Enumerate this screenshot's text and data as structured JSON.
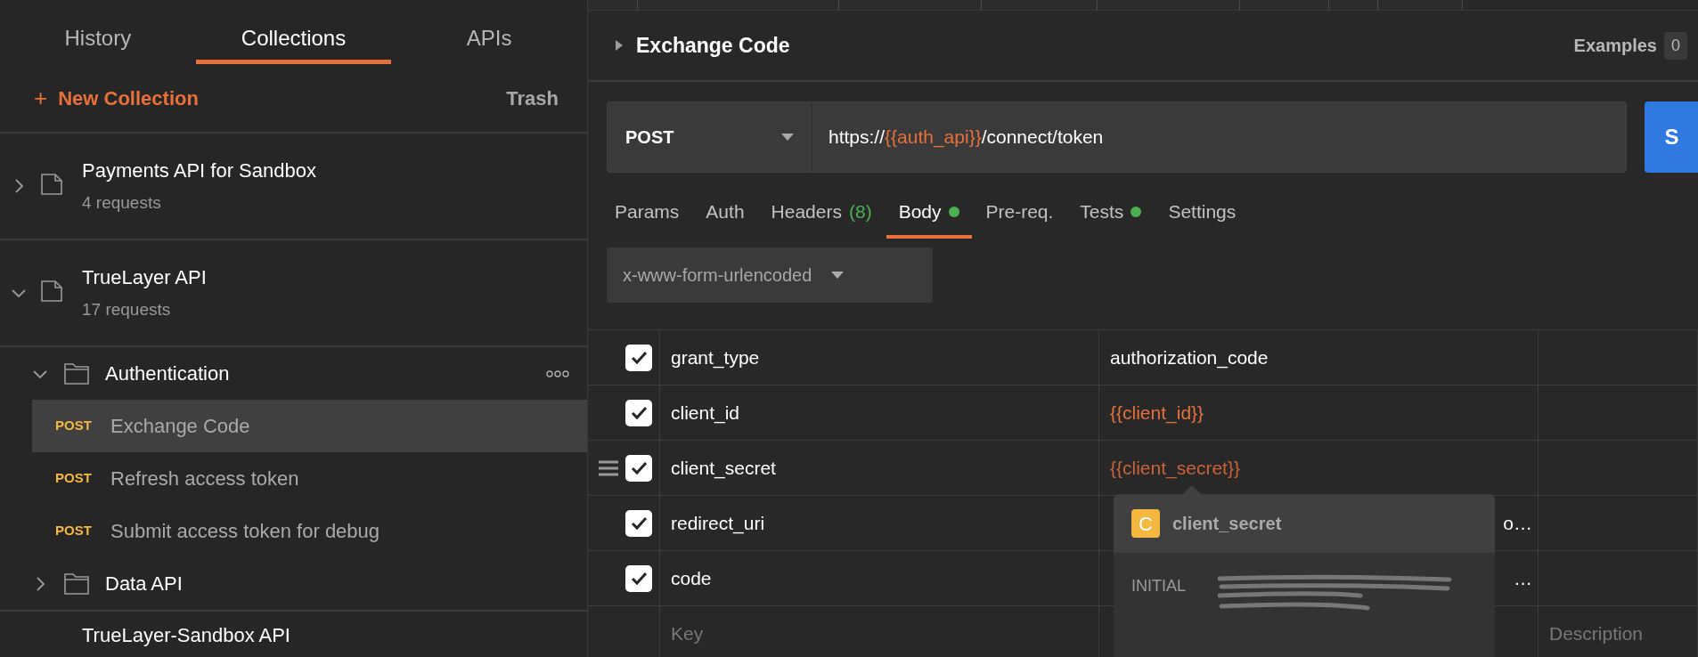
{
  "sidebar": {
    "tabs": [
      {
        "label": "History",
        "selected": false
      },
      {
        "label": "Collections",
        "selected": true
      },
      {
        "label": "APIs",
        "selected": false
      }
    ],
    "new_collection": {
      "icon": "+",
      "label": "New Collection"
    },
    "trash": "Trash",
    "collections": [
      {
        "name": "Payments API for Sandbox",
        "count": "4 requests",
        "expanded": false
      },
      {
        "name": "TrueLayer API",
        "count": "17 requests",
        "expanded": true,
        "children": [
          {
            "kind": "folder",
            "name": "Authentication",
            "expanded": true,
            "children": [
              {
                "kind": "request",
                "method": "POST",
                "name": "Exchange Code",
                "selected": true
              },
              {
                "kind": "request",
                "method": "POST",
                "name": "Refresh access token",
                "selected": false
              },
              {
                "kind": "request",
                "method": "POST",
                "name": "Submit access token for debug",
                "selected": false
              }
            ]
          },
          {
            "kind": "folder",
            "name": "Data API",
            "expanded": false
          }
        ]
      },
      {
        "name": "TrueLayer-Sandbox API"
      }
    ]
  },
  "main": {
    "title": "Exchange Code",
    "examples": {
      "label": "Examples",
      "count": "0"
    },
    "request": {
      "method": "POST",
      "url": [
        {
          "text": "https://",
          "variable": false
        },
        {
          "text": "{{auth_api}}",
          "variable": true
        },
        {
          "text": "/connect/token",
          "variable": false
        }
      ],
      "send": "S"
    },
    "tabs": [
      {
        "label": "Params",
        "selected": false,
        "dot": false
      },
      {
        "label": "Auth",
        "selected": false,
        "dot": false
      },
      {
        "label": "Headers",
        "badge": "(8)",
        "selected": false,
        "dot": false
      },
      {
        "label": "Body",
        "selected": true,
        "dot": true
      },
      {
        "label": "Pre-req.",
        "selected": false,
        "dot": false
      },
      {
        "label": "Tests",
        "selected": false,
        "dot": true
      },
      {
        "label": "Settings",
        "selected": false,
        "dot": false
      }
    ],
    "body_type": "x-www-form-urlencoded",
    "params": [
      {
        "checked": true,
        "key": "grant_type",
        "value": "authorization_code",
        "variable": false,
        "hovered": false
      },
      {
        "checked": true,
        "key": "client_id",
        "value": "{{client_id}}",
        "variable": true,
        "hovered": false
      },
      {
        "checked": true,
        "key": "client_secret",
        "value": "{{client_secret}}",
        "variable": true,
        "hovered": true
      },
      {
        "checked": true,
        "key": "redirect_uri",
        "value": "o…",
        "variable": false,
        "hovered": false
      },
      {
        "checked": true,
        "key": "code",
        "value": "…",
        "variable": false,
        "hovered": false
      }
    ],
    "new_row": {
      "key_placeholder": "Key",
      "description_placeholder": "Description"
    },
    "tooltip": {
      "badge": "C",
      "name": "client_secret",
      "label": "INITIAL"
    }
  }
}
